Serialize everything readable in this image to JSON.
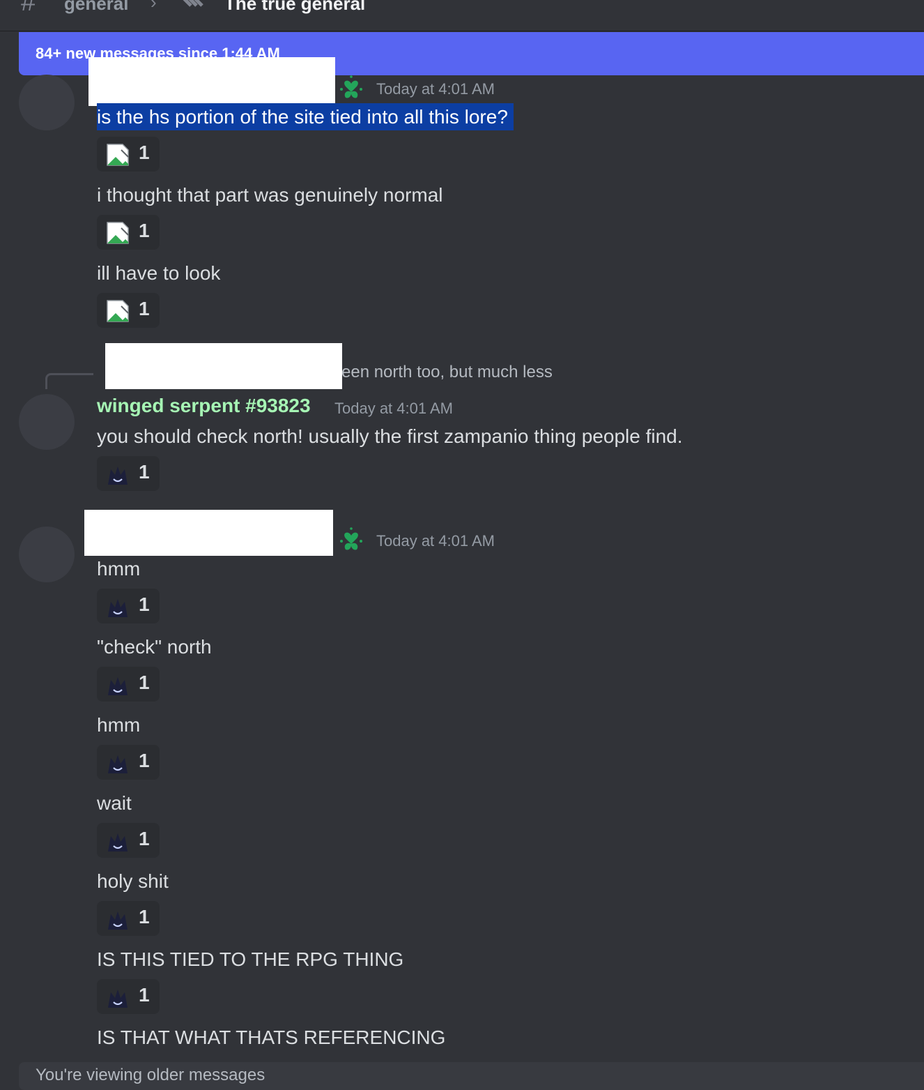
{
  "header": {
    "channel_name": "general",
    "thread_name": "The true general"
  },
  "new_messages_bar": {
    "text": "84+ new messages since 1:44 AM"
  },
  "groups": [
    {
      "timestamp": "Today at 4:01 AM",
      "messages": [
        {
          "text": "is the hs portion of the site tied into all this lore?",
          "selected": true,
          "reaction_count": "1"
        },
        {
          "text": "i thought that part was genuinely normal",
          "reaction_count": "1"
        },
        {
          "text": "ill have to look",
          "reaction_count": "1"
        }
      ]
    },
    {
      "reply_preview": "een north too, but much less",
      "author": "winged serpent #93823",
      "timestamp": "Today at 4:01 AM",
      "messages": [
        {
          "text": "you should check north! usually the first zampanio thing people find.",
          "reaction_count": "1"
        }
      ]
    },
    {
      "timestamp": "Today at 4:01 AM",
      "messages": [
        {
          "text": "hmm",
          "reaction_count": "1"
        },
        {
          "text": "\"check\" north",
          "reaction_count": "1"
        },
        {
          "text": "hmm",
          "reaction_count": "1"
        },
        {
          "text": "wait",
          "reaction_count": "1"
        },
        {
          "text": "holy shit",
          "reaction_count": "1"
        },
        {
          "text": "IS THIS TIED TO THE RPG THING",
          "reaction_count": "1"
        },
        {
          "text": "IS THAT WHAT THATS REFERENCING"
        }
      ]
    }
  ],
  "composer": {
    "text": "You're viewing older messages"
  },
  "colors": {
    "background": "#313338",
    "new_messages_bar": "#5865f2",
    "username_color": "#a6f5b4",
    "badge_green": "#23a55a",
    "selection": "#0c3ea3"
  }
}
